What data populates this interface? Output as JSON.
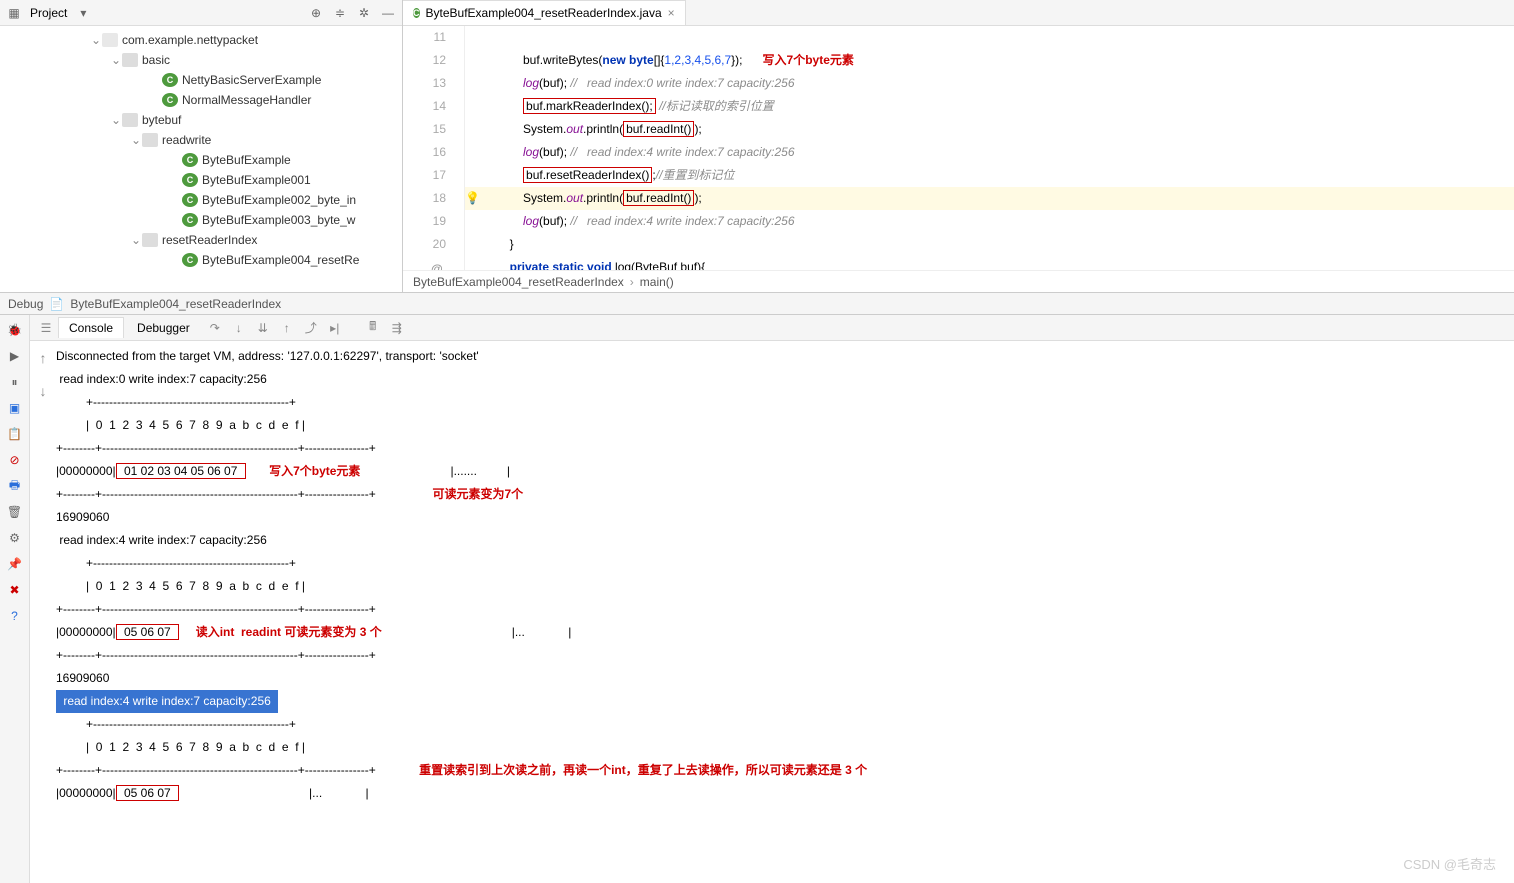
{
  "project": {
    "title": "Project",
    "tree": [
      {
        "pad": 90,
        "arr": "⌄",
        "icon": "pkg",
        "label": "com.example.nettypacket"
      },
      {
        "pad": 110,
        "arr": "⌄",
        "icon": "folder",
        "label": "basic"
      },
      {
        "pad": 150,
        "arr": "",
        "icon": "cls",
        "label": "NettyBasicServerExample"
      },
      {
        "pad": 150,
        "arr": "",
        "icon": "cls",
        "label": "NormalMessageHandler"
      },
      {
        "pad": 110,
        "arr": "⌄",
        "icon": "folder",
        "label": "bytebuf"
      },
      {
        "pad": 130,
        "arr": "⌄",
        "icon": "folder",
        "label": "readwrite"
      },
      {
        "pad": 170,
        "arr": "",
        "icon": "cls",
        "label": "ByteBufExample"
      },
      {
        "pad": 170,
        "arr": "",
        "icon": "cls",
        "label": "ByteBufExample001"
      },
      {
        "pad": 170,
        "arr": "",
        "icon": "cls",
        "label": "ByteBufExample002_byte_in"
      },
      {
        "pad": 170,
        "arr": "",
        "icon": "cls",
        "label": "ByteBufExample003_byte_w"
      },
      {
        "pad": 130,
        "arr": "⌄",
        "icon": "folder",
        "label": "resetReaderIndex"
      },
      {
        "pad": 170,
        "arr": "",
        "icon": "cls",
        "label": "ByteBufExample004_resetRe",
        "hl": true
      }
    ]
  },
  "editor": {
    "tab_label": "ByteBufExample004_resetReaderIndex.java",
    "gutter": [
      "11",
      "12",
      "13",
      "14",
      "15",
      "16",
      "17",
      "18",
      "19",
      "20"
    ],
    "breadcrumb": [
      "ByteBufExample004_resetReaderIndex",
      "main()"
    ],
    "code": {
      "l11_pre": "            buf.writeBytes(",
      "l11_new": "new ",
      "l11_byte": "byte",
      "l11_arr": "[]{",
      "l11_nums": "1,2,3,4,5,6,7",
      "l11_end": "});",
      "l11_ann": "写入7个byte元素",
      "l12_log": "            log",
      "l12_buf": "(buf); ",
      "l12_cmt": "//   read index:0 write index:7 capacity:256",
      "l13_box": "buf.markReaderIndex();",
      "l13_cmt": " //标记读取的索引位置",
      "l14_pre": "            System.",
      "l14_out": "out",
      "l14_print": ".println(",
      "l14_box": "buf.readInt()",
      "l14_end": ");",
      "l15_log": "            log",
      "l15_buf": "(buf); ",
      "l15_cmt": "//   read index:4 write index:7 capacity:256",
      "l16_box": "buf.resetReaderIndex()",
      "l16_end": ";",
      "l16_cmt": "//重置到标记位",
      "l17_pre": "            System.",
      "l17_out": "out",
      "l17_print": ".println(",
      "l17_box": "buf.readInt()",
      "l17_end": ");",
      "l18_log": "            log",
      "l18_buf": "(buf); ",
      "l18_cmt": "//   read index:4 write index:7 capacity:256",
      "l19": "        }",
      "l20_pre": "        ",
      "l20_private": "private static void ",
      "l20_sig": "log(ByteBuf buf){"
    }
  },
  "debug": {
    "title": "Debug",
    "run": "ByteBufExample004_resetReaderIndex"
  },
  "console": {
    "tab1": "Console",
    "tab2": "Debugger",
    "line_disconnect": "Disconnected from the target VM, address: '127.0.0.1:62297', transport: 'socket'",
    "line_idx0": " read index:0 write index:7 capacity:256",
    "header": "         +-------------------------------------------------+",
    "hexhdr": "         |  0  1  2  3  4  5  6  7  8  9  a  b  c  d  e  f |",
    "sep": "+--------+-------------------------------------------------+----------------+",
    "row0_pre": "|00000000|",
    "row0_hex": " 01 02 03 04 05 06 07 ",
    "row0_tail": "                           |.......         |",
    "ann1a": "写入7个byte元素",
    "ann1b": "可读元素变为7个",
    "val1": "16909060",
    "line_idx4": " read index:4 write index:7 capacity:256",
    "row1_pre": "|00000000|",
    "row1_hex": " 05 06 07 ",
    "row1_tail": "                                       |...             |",
    "ann2": "读入int  readint 可读元素变为 3 个",
    "val2": "16909060",
    "sel": " read index:4 write index:7 capacity:256 ",
    "ann3": "重置读索引到上次读之前，再读一个int，重复了上去读操作，所以可读元素还是 3 个",
    "row2_pre": "|00000000|",
    "row2_hex": " 05 06 07 ",
    "row2_tail": "                                       |...             |"
  },
  "watermark": "CSDN @毛奇志"
}
